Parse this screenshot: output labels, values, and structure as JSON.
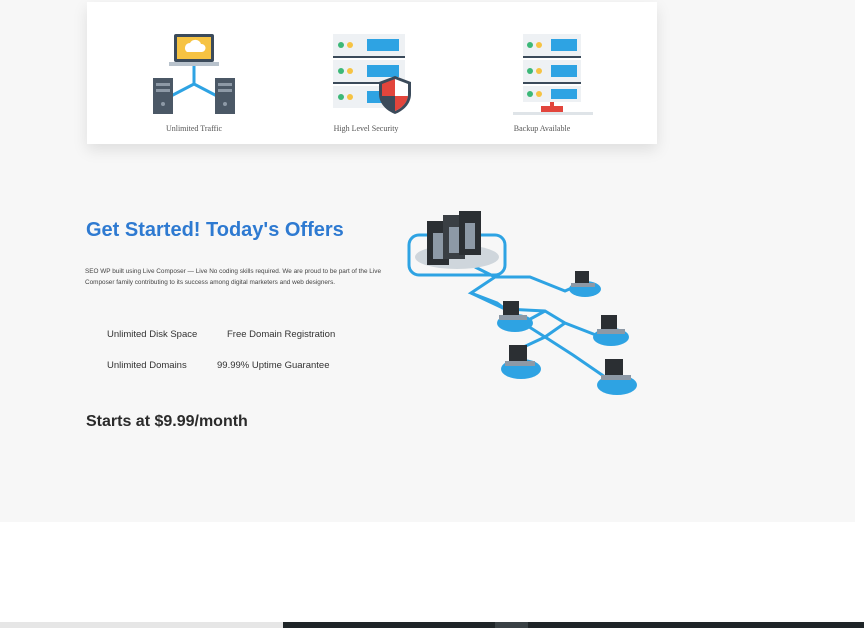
{
  "features": [
    {
      "label": "Unlimited Traffic",
      "icon": "network-servers-icon"
    },
    {
      "label": "High Level Security",
      "icon": "server-shield-icon"
    },
    {
      "label": "Backup Available",
      "icon": "server-backup-icon"
    }
  ],
  "offer": {
    "title": "Get Started! Today's Offers",
    "description": "SEO WP built using Live Composer — Live No coding skills required. We are proud to be part of the Live Composer family contributing to its success among digital marketers and web designers.",
    "items": [
      "Unlimited Disk Space",
      "Free Domain Registration",
      "Unlimited Domains",
      "99.99% Uptime Guarantee"
    ],
    "price": "Starts at $9.99/month"
  },
  "colors": {
    "accent": "#2e7ad1",
    "network_line": "#2ea3e3",
    "background": "#f7f7f7"
  }
}
